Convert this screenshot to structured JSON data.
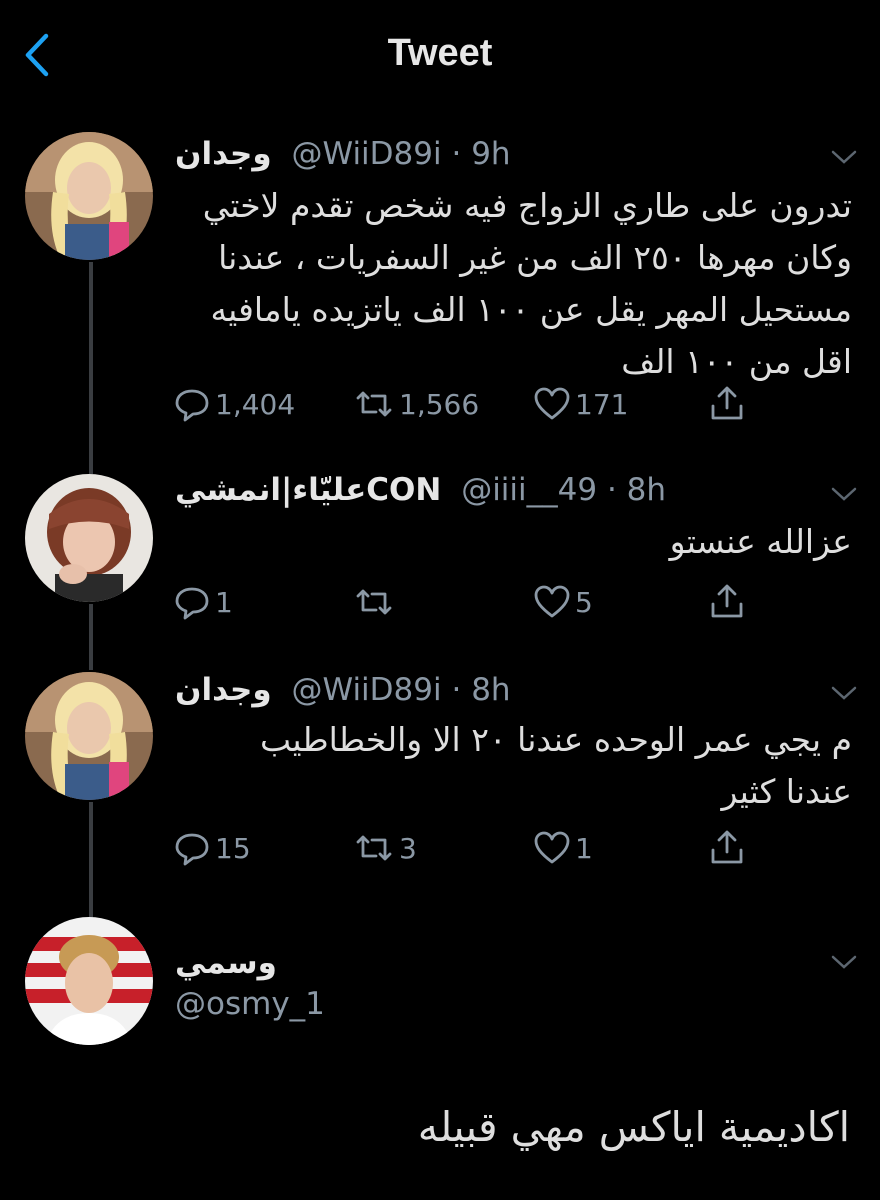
{
  "header": {
    "title": "Tweet"
  },
  "tweets": [
    {
      "name": "وجدان",
      "handle": "@WiiD89i",
      "time": "9h",
      "lines": [
        "تدرون على طاري الزواج فيه شخص تقدم لاختي",
        "وكان مهرها ٢٥٠ الف من غير السفريات ، عندنا",
        "مستحيل المهر يقل عن ١٠٠ الف ياتزيده يامافيه",
        "اقل من ١٠٠ الف"
      ],
      "replies": "1,404",
      "retweets": "1,566",
      "likes": "171"
    },
    {
      "name": "عليّاء|انمشيCON",
      "handle": "@iiii__49",
      "time": "8h",
      "lines": [
        "عزالله عنستو"
      ],
      "replies": "1",
      "retweets": "",
      "likes": "5"
    },
    {
      "name": "وجدان",
      "handle": "@WiiD89i",
      "time": "8h",
      "lines": [
        "م يجي عمر الوحده عندنا ٢٠ الا والخطاطيب",
        "عندنا كثير"
      ],
      "replies": "15",
      "retweets": "3",
      "likes": "1"
    },
    {
      "name": "وسمي",
      "handle": "@osmy_1"
    }
  ],
  "dot": "·",
  "closing_text": "اكاديمية اياكس مهي قبيله",
  "colors": {
    "background": "#000000",
    "accent": "#1da1f2",
    "muted": "#8b98a5",
    "thread_line": "#3a3d41"
  }
}
